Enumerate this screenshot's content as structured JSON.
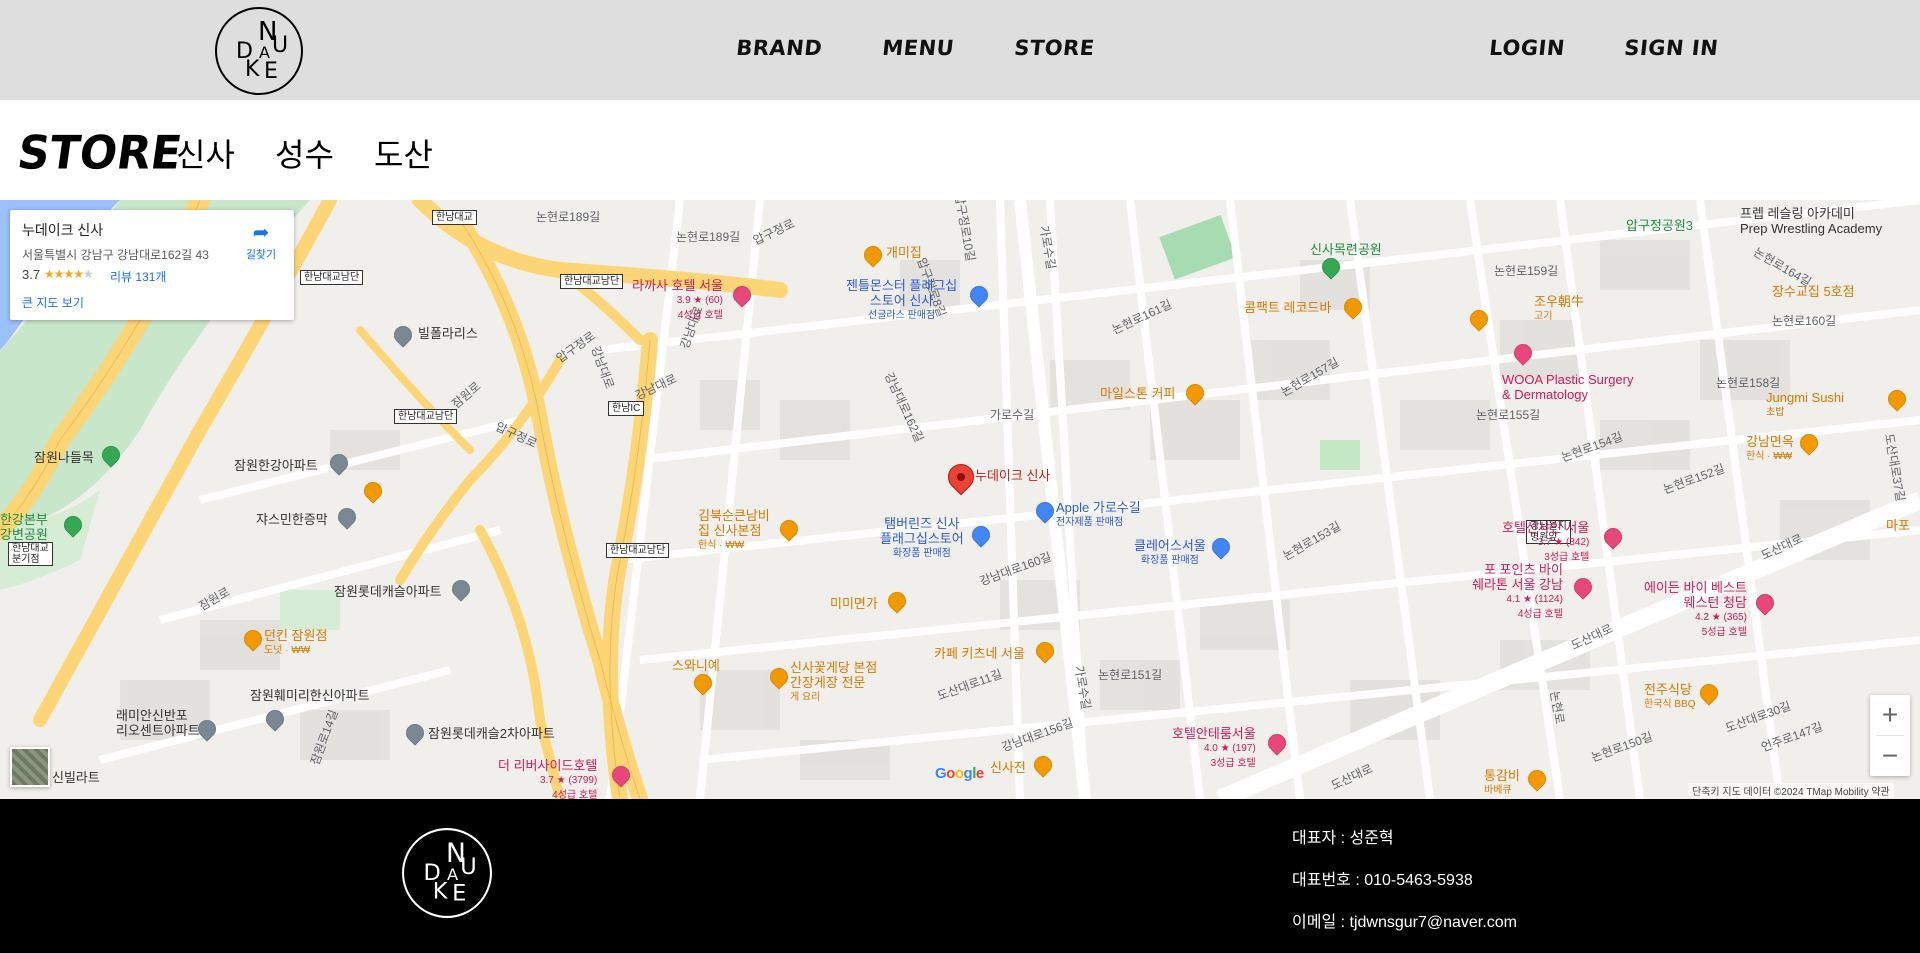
{
  "header": {
    "logo_letters": "NAUDKE",
    "nav": {
      "brand": "BRAND",
      "menu": "MENU",
      "store": "STORE"
    },
    "auth": {
      "login": "LOGIN",
      "signin": "SIGN IN"
    }
  },
  "store_bar": {
    "title": "STORE",
    "tabs": [
      {
        "label": "신사"
      },
      {
        "label": "성수"
      },
      {
        "label": "도산"
      }
    ]
  },
  "map": {
    "info_card": {
      "name": "누데이크 신사",
      "address": "서울특별시 강남구 강남대로162길 43",
      "rating": "3.7",
      "stars": "★★★★",
      "stars_off": "★",
      "reviews": "리뷰 131개",
      "big_map": "큰 지도 보기",
      "directions": "길찾기"
    },
    "marker_label": "누데이크 신사",
    "places": {
      "gaemijip": "개미집",
      "lakaja": "라까사 호텔 서울",
      "lakaja_sub1": "3.9 ★ (60)",
      "lakaja_sub2": "4성급 호텔",
      "gentle": "젠틀몬스터 플래그십",
      "gentle2": "스토어 신사",
      "gentle_sub": "선글라스 판매점",
      "apple": "Apple 가로수길",
      "apple_sub": "전자제품 판매점",
      "tamburins": "탬버린즈 신사",
      "tamburins2": "플래그십스토어",
      "tamburins_sub": "화장품 판매점",
      "kimbuk": "김북순큰남비",
      "kimbuk2": "집 신사본점",
      "kimbuk_sub": "한식 · ₩₩",
      "mimi": "미미면가",
      "cafe_kitchen": "카페 키츠네 서울",
      "clearskin": "클레어스서울",
      "clearskin_sub": "화장품 판매점",
      "milestone": "마일스톤 커피",
      "compact": "콤팩트 레코드바",
      "joujoe": "조우朝牛",
      "joujoe_sub": "고기",
      "wooa": "WOOA Plastic Surgery",
      "wooa2": "& Dermatology",
      "jungmi": "Jungmi Sushi",
      "jungmi_sub": "초밥",
      "gangnam_myeon": "강남면옥",
      "gangnam_myeon_sub": "한식 · ₩₩",
      "jangsu": "장수교집 5호점",
      "sinsa_park": "신사목련공원",
      "apgujeong_park": "압구정공원3",
      "prep": "프렙 레슬링 아카데미",
      "prep2": "Prep Wrestling Academy",
      "hotel_sunshine": "호텔선샤인 서울",
      "hotel_sunshine_sub1": "3.7 ★ (342)",
      "hotel_sunshine_sub2": "3성급 호텔",
      "four_points": "포 포인츠 바이",
      "four_points2": "쉐라톤 서울 강남",
      "four_points_sub1": "4.1 ★ (1124)",
      "four_points_sub2": "4성급 호텔",
      "aiden": "에이든 바이 베스트",
      "aiden2": "웨스턴 청담",
      "aiden_sub1": "4.2 ★ (365)",
      "aiden_sub2": "5성급 호텔",
      "hotel_antelum": "호텔안테룸서울",
      "hotel_antelum_sub1": "4.0 ★ (197)",
      "hotel_antelum_sub2": "3성급 호텔",
      "jeonju": "전주식당",
      "jeonju_sub": "한국식 BBQ",
      "donggeum": "통감비",
      "donggeum_sub": "바베큐",
      "sinsajeon": "신사전",
      "sinsa_crab": "신사꽃게당 본점",
      "sinsa_crab2": "간장게장 전문",
      "sinsa_crab_sub": "게 요리",
      "swanie": "스와니예",
      "river_side": "더 리버사이드호텔",
      "river_side_sub1": "3.7 ★ (3799)",
      "river_side_sub2": "4성급 호텔",
      "dunkin": "던킨 잠원점",
      "dunkin_sub": "도넛 · ₩₩",
      "jamwon_hangang": "잠원한강아파트",
      "jasmine": "쟈스민한증막",
      "bilpolarace": "빌폴라리스",
      "jamwon_lotte": "잠원롯데캐슬아파트",
      "jamwon_nadeul": "잠원나들목",
      "hangang_hq": "한강본부",
      "hangang_hq2": "강변공원",
      "jamwon_family": "잠원훼미리한신아파트",
      "raemian": "래미안신반포",
      "raemian2": "리오센트아파트",
      "jamwon_lotte2": "잠원롯데캐슬2차아파트",
      "villa": "신빌라트",
      "mapo": "마포"
    },
    "roads": {
      "hannam_bridge": "한남대교",
      "hannam_south": "한남대교남단",
      "hannam_south2": "한남대교남단",
      "hannam_south3": "한남대교남단",
      "hannam_south4": "한남대교남단",
      "hannam_ic": "한남IC",
      "hannam_bridge_bus": "한남대교",
      "hannam_bridge_bus2": "분기점",
      "gangnam_stn": "강남을지",
      "gangnam_stn2": "병원앞",
      "r1": "논현로189길",
      "r2": "논현로189길",
      "r3": "압구정로",
      "r4": "압구정로",
      "r5": "압구정로",
      "r6": "강남대로",
      "r7": "강남대로",
      "r8": "강남대로",
      "r9": "잠원로",
      "r10": "잠원로",
      "r11": "가로수길",
      "r12": "가로수길",
      "r13": "가로수길",
      "r14": "논현로161길",
      "r15": "논현로159길",
      "r16": "논현로155길",
      "r17": "논현로157길",
      "r18": "논현로153길",
      "r19": "논현로151길",
      "r20": "강남대로160길",
      "r21": "강남대로156길",
      "r22": "강남대로162길",
      "r23": "도산대로",
      "r24": "도산대로",
      "r25": "도산대로",
      "r26": "논현로152길",
      "r27": "논현로154길",
      "r28": "논현로158길",
      "r29": "논현로160길",
      "r30": "논현로164길",
      "r31": "논현로150길",
      "r32": "언주로147길",
      "r33": "도산대로30길",
      "r34": "도산대로37길",
      "r35": "잠원로14길",
      "r36": "논현로",
      "r37": "압구정로10길",
      "r38": "압구정로8길",
      "r39": "도산대로11길"
    },
    "google": [
      "G",
      "o",
      "o",
      "g",
      "l",
      "e"
    ],
    "attribution": "단축키  지도 데이터 ©2024 TMap Mobility  약관",
    "zoom_in": "+",
    "zoom_out": "−"
  },
  "footer": {
    "ceo": "대표자 : 성준혁",
    "phone": "대표번호 : 010-5463-5938",
    "email": "이메일 : tjdwnsgur7@naver.com"
  },
  "colors": {
    "header_bg": "#dedede",
    "footer_bg": "#000000",
    "highway": "#fcd576",
    "river": "#9cc0f9",
    "park": "#c5e8c5",
    "marker": "#ea4335"
  }
}
